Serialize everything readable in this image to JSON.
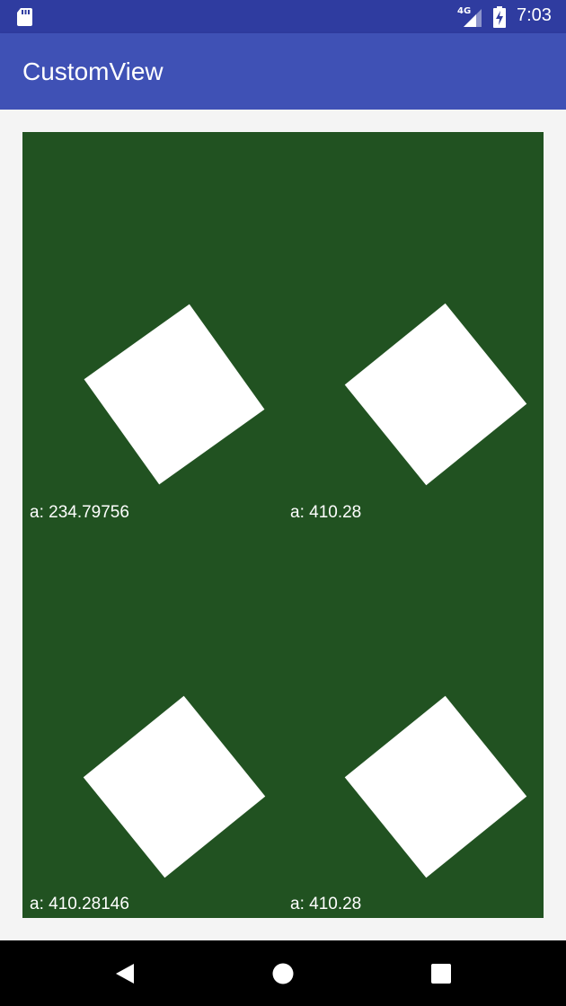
{
  "status_bar": {
    "network": "4G",
    "time": "7:03",
    "icons": [
      "sd-card-icon",
      "signal-icon",
      "battery-charging-icon"
    ]
  },
  "app_bar": {
    "title": "CustomView"
  },
  "custom_view": {
    "background_color": "#215221",
    "shape_color": "#ffffff",
    "cells": [
      {
        "label": "a: 234.79756"
      },
      {
        "label": "a: 410.28"
      },
      {
        "label": "a: 410.28146"
      },
      {
        "label": "a: 410.28"
      }
    ]
  },
  "nav_bar": {
    "buttons": [
      "back-icon",
      "home-icon",
      "recents-icon"
    ]
  },
  "colors": {
    "status_bar": "#2f3ca0",
    "app_bar": "#3f51b5",
    "nav_bar": "#000000"
  }
}
